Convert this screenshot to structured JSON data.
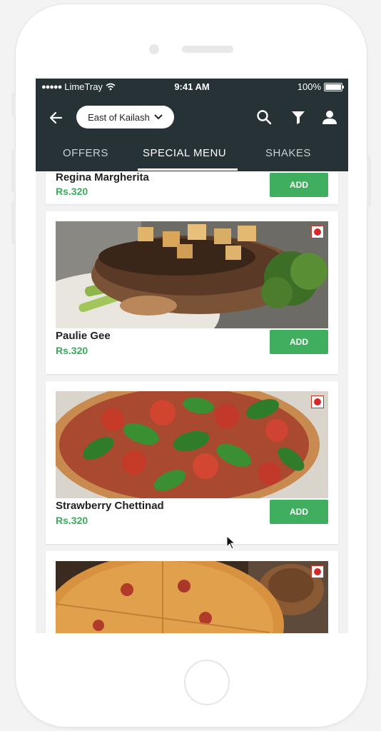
{
  "status": {
    "carrier": "LimeTray",
    "signal": "●●●●●",
    "time": "9:41 AM",
    "battery": "100%"
  },
  "header": {
    "location": "East of Kailash"
  },
  "tabs": [
    {
      "label": "OFFERS"
    },
    {
      "label": "SPECIAL MENU"
    },
    {
      "label": "SHAKES"
    }
  ],
  "items": [
    {
      "name": "Regina Margherita",
      "price": "Rs.320",
      "add": "ADD"
    },
    {
      "name": "Paulie Gee",
      "price": "Rs.320",
      "add": "ADD"
    },
    {
      "name": "Strawberry Chettinad",
      "price": "Rs.320",
      "add": "ADD"
    }
  ],
  "colors": {
    "header_bg": "#263235",
    "accent_green": "#3fae5f",
    "price_green": "#3aaa5c"
  },
  "icons": [
    "back-arrow-icon",
    "chevron-down-icon",
    "search-icon",
    "filter-icon",
    "user-icon",
    "veg-indicator-icon"
  ]
}
